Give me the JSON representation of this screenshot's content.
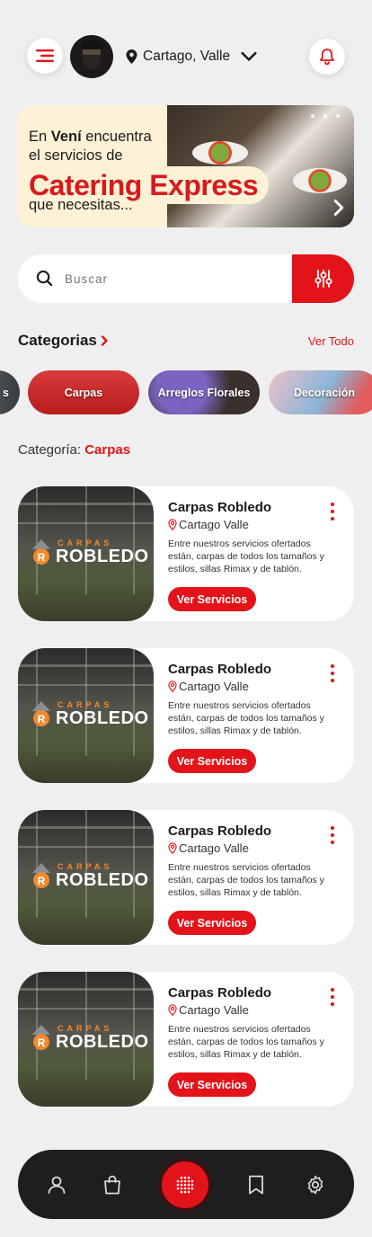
{
  "header": {
    "location": "Cartago, Valle"
  },
  "banner": {
    "line1_prefix": "En ",
    "line1_bold": "Vení",
    "line1_suffix": " encuentra",
    "line2": "el servicios de",
    "headline": "Catering Express",
    "line3": "que necesitas..."
  },
  "search": {
    "placeholder": "Buscar"
  },
  "categories": {
    "title": "Categorias",
    "see_all": "Ver Todo",
    "chips": [
      {
        "label": "s"
      },
      {
        "label": "Carpas"
      },
      {
        "label": "Arreglos Florales"
      },
      {
        "label": "Decoración"
      }
    ]
  },
  "current_category": {
    "label": "Categoría: ",
    "value": "Carpas"
  },
  "listings": [
    {
      "logo_small": "CARPAS",
      "logo_big": "ROBLEDO",
      "name": "Carpas Robledo",
      "location": "Cartago Valle",
      "description": "Entre nuestros servicios ofertados están, carpas de todos los tamaños y estilos, sillas Rimax y de tablón.",
      "cta": "Ver  Servicios"
    },
    {
      "logo_small": "CARPAS",
      "logo_big": "ROBLEDO",
      "name": "Carpas Robledo",
      "location": "Cartago Valle",
      "description": "Entre nuestros servicios ofertados están, carpas de todos los tamaños y estilos, sillas Rimax y de tablón.",
      "cta": "Ver  Servicios"
    },
    {
      "logo_small": "CARPAS",
      "logo_big": "ROBLEDO",
      "name": "Carpas Robledo",
      "location": "Cartago Valle",
      "description": "Entre nuestros servicios ofertados están, carpas de todos los tamaños y estilos, sillas Rimax y de tablón.",
      "cta": "Ver  Servicios"
    },
    {
      "logo_small": "CARPAS",
      "logo_big": "ROBLEDO",
      "name": "Carpas Robledo",
      "location": "Cartago Valle",
      "description": "Entre nuestros servicios ofertados están, carpas de todos los tamaños y estilos, sillas Rimax y de tablón.",
      "cta": "Ver  Servicios"
    }
  ],
  "bottom_nav": {
    "items": [
      {
        "icon": "user-icon"
      },
      {
        "icon": "shopping-bag-icon"
      },
      {
        "icon": "app-grid-icon"
      },
      {
        "icon": "bookmark-icon"
      },
      {
        "icon": "settings-icon"
      }
    ]
  },
  "colors": {
    "accent": "#e2141a",
    "background": "#efefef",
    "nav_bg": "#1e1e1e"
  }
}
